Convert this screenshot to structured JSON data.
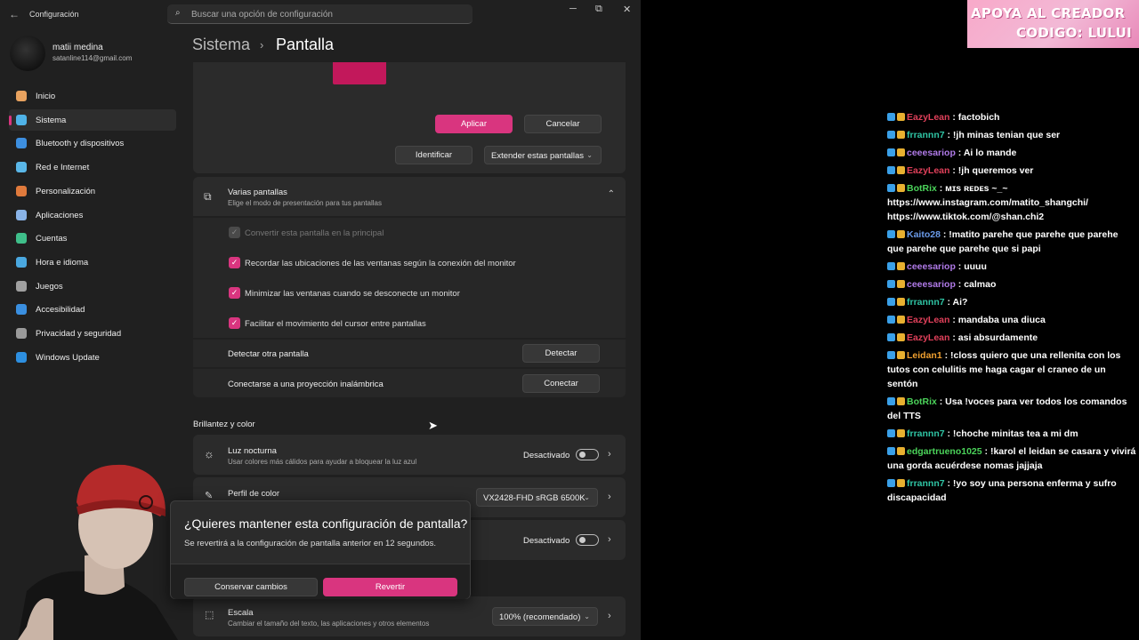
{
  "window": {
    "app_title": "Configuración",
    "search_placeholder": "Buscar una opción de configuración",
    "minimize_glyph": "─",
    "maximize_glyph": "⧉",
    "close_glyph": "✕"
  },
  "profile": {
    "name": "matii medina",
    "email": "satanline114@gmail.com"
  },
  "sidebar": {
    "items": [
      {
        "label": "Inicio",
        "icon": "home-icon",
        "color": "#e8a25f"
      },
      {
        "label": "Sistema",
        "icon": "system-icon",
        "color": "#4fb3e8",
        "selected": true
      },
      {
        "label": "Bluetooth y dispositivos",
        "icon": "bluetooth-icon",
        "color": "#3d8fe0"
      },
      {
        "label": "Red e Internet",
        "icon": "wifi-icon",
        "color": "#5ab7e8"
      },
      {
        "label": "Personalización",
        "icon": "brush-icon",
        "color": "#e07a3c"
      },
      {
        "label": "Aplicaciones",
        "icon": "apps-icon",
        "color": "#8ab4e8"
      },
      {
        "label": "Cuentas",
        "icon": "person-icon",
        "color": "#3fbf8a"
      },
      {
        "label": "Hora e idioma",
        "icon": "globe-clock-icon",
        "color": "#4aa8e0"
      },
      {
        "label": "Juegos",
        "icon": "gamepad-icon",
        "color": "#a0a0a0"
      },
      {
        "label": "Accesibilidad",
        "icon": "accessibility-icon",
        "color": "#3a8fe0"
      },
      {
        "label": "Privacidad y seguridad",
        "icon": "shield-icon",
        "color": "#9a9a9a"
      },
      {
        "label": "Windows Update",
        "icon": "update-icon",
        "color": "#2d8fe0"
      }
    ]
  },
  "breadcrumb": {
    "parent": "Sistema",
    "separator": "›",
    "current": "Pantalla"
  },
  "accent_color": "#d9357f",
  "display_card": {
    "apply_label": "Aplicar",
    "cancel_label": "Cancelar",
    "identify_label": "Identificar",
    "extend_select": "Extender estas pantallas"
  },
  "multiple_displays": {
    "title": "Varias pantallas",
    "subtitle": "Elige el modo de presentación para tus pantallas",
    "options": [
      {
        "label": "Convertir esta pantalla en la principal",
        "checked": true,
        "disabled": true
      },
      {
        "label": "Recordar las ubicaciones de las ventanas según la conexión del monitor",
        "checked": true
      },
      {
        "label": "Minimizar las ventanas cuando se desconecte un monitor",
        "checked": true
      },
      {
        "label": "Facilitar el movimiento del cursor entre pantallas",
        "checked": true
      }
    ],
    "detect_label": "Detectar otra pantalla",
    "detect_button": "Detectar",
    "connect_label": "Conectarse a una proyección inalámbrica",
    "connect_button": "Conectar"
  },
  "brightness_section": {
    "heading": "Brillantez y color"
  },
  "night_light": {
    "title": "Luz nocturna",
    "subtitle": "Usar colores más cálidos para ayudar a bloquear la luz azul",
    "state": "Desactivado"
  },
  "color_profile": {
    "title": "Perfil de color",
    "value": "VX2428-FHD sRGB 6500K"
  },
  "hdr_row": {
    "state": "Desactivado"
  },
  "scale": {
    "title": "Escala",
    "subtitle": "Cambiar el tamaño del texto, las aplicaciones y otros elementos",
    "value": "100% (recomendado)"
  },
  "dialog": {
    "title": "¿Quieres mantener esta configuración de pantalla?",
    "body": "Se revertirá a la configuración de pantalla anterior en 12 segundos.",
    "keep_label": "Conservar cambios",
    "revert_label": "Revertir"
  },
  "banner": {
    "line1": "APOYA AL CREADOR",
    "line2": "CODIGO: LULUI"
  },
  "chat": [
    {
      "user": "EazyLean",
      "color": "#e0405a",
      "text": "factobich"
    },
    {
      "user": "frrannn7",
      "color": "#2fc4a4",
      "text": "!jh minas tenian que ser"
    },
    {
      "user": "ceeesariop",
      "color": "#b07ae8",
      "text": "Ai lo mande"
    },
    {
      "user": "EazyLean",
      "color": "#e0405a",
      "text": "!jh queremos ver"
    },
    {
      "user": "BotRix",
      "color": "#4bd35a",
      "text": "ᴍɪs ʀᴇᴅᴇs ~_~ https://www.instagram.com/matito_shangchi/ https://www.tiktok.com/@shan.chi2"
    },
    {
      "user": "Kaito28",
      "color": "#6a9ae8",
      "text": "!matito parehe que parehe que parehe que parehe que parehe que si papi"
    },
    {
      "user": "ceeesariop",
      "color": "#b07ae8",
      "text": "uuuu"
    },
    {
      "user": "ceeesariop",
      "color": "#b07ae8",
      "text": "calmao"
    },
    {
      "user": "frrannn7",
      "color": "#2fc4a4",
      "text": "Ai?"
    },
    {
      "user": "EazyLean",
      "color": "#e0405a",
      "text": "mandaba una diuca"
    },
    {
      "user": "EazyLean",
      "color": "#e0405a",
      "text": "asi absurdamente"
    },
    {
      "user": "Leidan1",
      "color": "#f0a030",
      "text": "!closs quiero que una rellenita con los tutos con celulitis me haga cagar el craneo de un sentón"
    },
    {
      "user": "BotRix",
      "color": "#4bd35a",
      "text": "Usa !voces para ver todos los comandos del TTS"
    },
    {
      "user": "frrannn7",
      "color": "#2fc4a4",
      "text": "!choche minitas tea a mi dm"
    },
    {
      "user": "edgartrueno1025",
      "color": "#4bd35a",
      "text": "!karol el leidan se casara y vivirá una gorda acuérdese nomas jajjaja"
    },
    {
      "user": "frrannn7",
      "color": "#2fc4a4",
      "text": "!yo soy una persona enferma y sufro discapacidad"
    }
  ]
}
